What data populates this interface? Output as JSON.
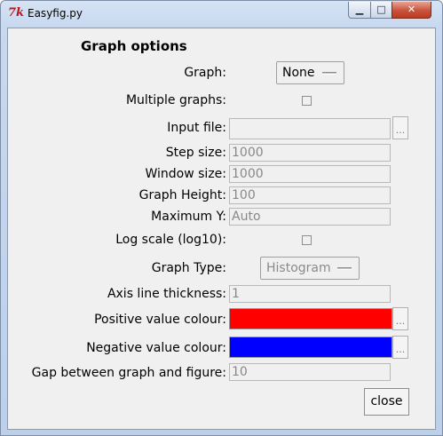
{
  "window": {
    "title": "Easyfig.py",
    "app_icon": "tk-feather-icon"
  },
  "heading": "Graph options",
  "labels": {
    "graph": "Graph:",
    "multiple_graphs": "Multiple graphs:",
    "input_file": "Input file:",
    "step_size": "Step size:",
    "window_size": "Window size:",
    "graph_height": "Graph Height:",
    "maximum_y": "Maximum Y:",
    "log_scale": "Log scale (log10):",
    "graph_type": "Graph Type:",
    "axis_line_thickness": "Axis line thickness:",
    "positive_colour": "Positive value colour:",
    "negative_colour": "Negative value colour:",
    "gap": "Gap between graph and figure:"
  },
  "values": {
    "graph": "None",
    "input_file": "",
    "step_size": "1000",
    "window_size": "1000",
    "graph_height": "100",
    "maximum_y": "Auto",
    "graph_type": "Histogram",
    "axis_line_thickness": "1",
    "gap": "10"
  },
  "checkboxes": {
    "multiple_graphs": false,
    "log_scale": false
  },
  "colours": {
    "positive": "#ff0000",
    "negative": "#0000ff"
  },
  "browse_label": "...",
  "close_label": "close",
  "title_buttons": {
    "minimize": "▁",
    "maximize": "□",
    "close": "✕"
  }
}
